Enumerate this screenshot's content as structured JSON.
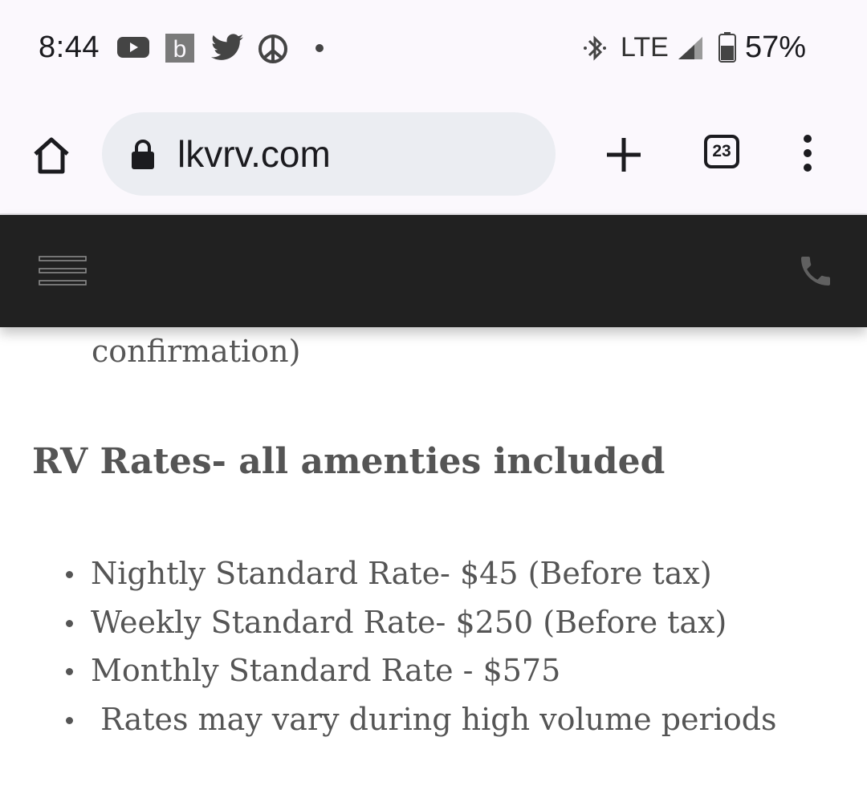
{
  "status_bar": {
    "time": "8:44",
    "notification_icons": [
      "youtube-icon",
      "b-app-icon",
      "twitter-icon",
      "peace-icon",
      "more-dot-icon"
    ],
    "network": "LTE",
    "battery": "57%",
    "battery_level": 0.57
  },
  "browser": {
    "url": "lkvrv.com",
    "tab_count": "23"
  },
  "site_header": {
    "background": "#212121",
    "icons": [
      "hamburger-menu-icon",
      "phone-icon"
    ]
  },
  "content": {
    "cut_text": "confirmation)",
    "heading": "RV Rates- all amenties included",
    "rates": [
      "Nightly Standard Rate- $45 (Before tax)",
      "Weekly Standard Rate- $250 (Before tax)",
      "Monthly Standard Rate - $575",
      " Rates may vary during high volume periods"
    ]
  }
}
